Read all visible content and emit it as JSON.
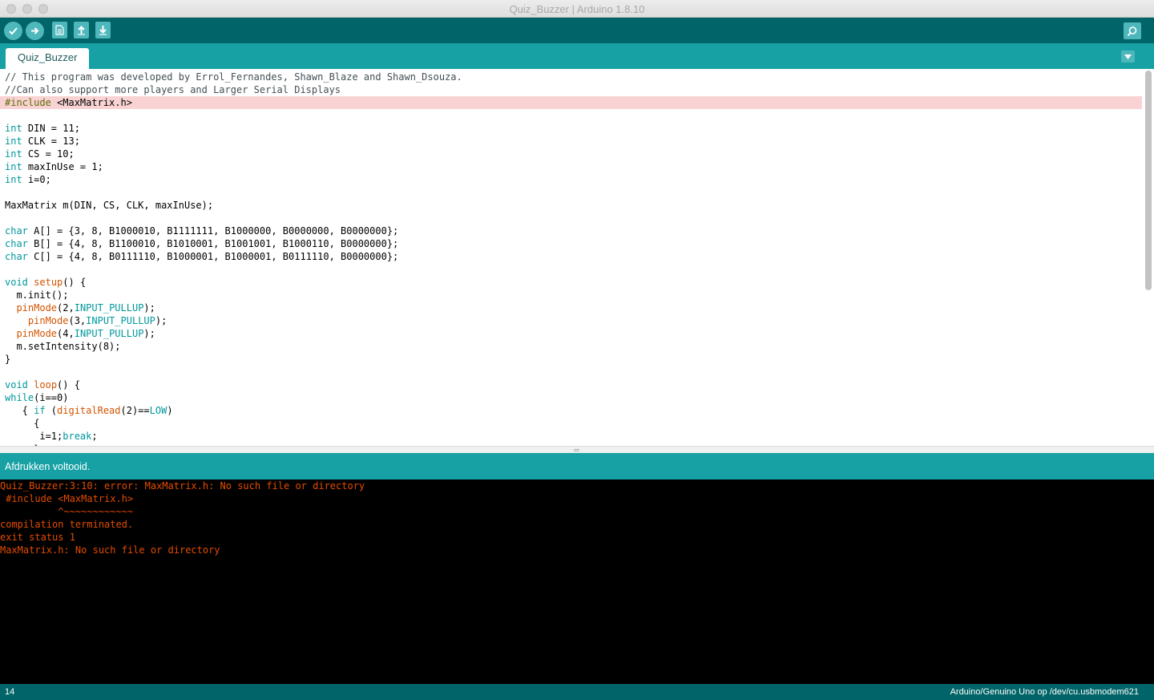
{
  "window": {
    "title": "Quiz_Buzzer | Arduino 1.8.10"
  },
  "toolbar": {
    "buttons": [
      {
        "name": "verify",
        "icon": "checkmark-icon"
      },
      {
        "name": "upload",
        "icon": "arrow-right-icon"
      },
      {
        "name": "new",
        "icon": "new-sketch-icon"
      },
      {
        "name": "open",
        "icon": "arrow-up-icon"
      },
      {
        "name": "save",
        "icon": "arrow-down-icon"
      }
    ],
    "serial_monitor_icon": "magnifier-icon"
  },
  "tabs": [
    {
      "label": "Quiz_Buzzer",
      "active": true
    }
  ],
  "editor": {
    "error_line": 3,
    "lines": [
      "// This program was developed by Errol_Fernandes, Shawn_Blaze and Shawn_Dsouza.",
      "//Can also support more players and Larger Serial Displays",
      "#include <MaxMatrix.h>",
      "",
      "int DIN = 11;",
      "int CLK = 13;",
      "int CS = 10;",
      "int maxInUse = 1;",
      "int i=0;",
      "",
      "MaxMatrix m(DIN, CS, CLK, maxInUse);",
      "",
      "char A[] = {3, 8, B1000010, B1111111, B1000000, B0000000, B0000000};",
      "char B[] = {4, 8, B1100010, B1010001, B1001001, B1000110, B0000000};",
      "char C[] = {4, 8, B0111110, B1000001, B1000001, B0111110, B0000000};",
      "",
      "void setup() {",
      "  m.init();",
      "  pinMode(2,INPUT_PULLUP);",
      "    pinMode(3,INPUT_PULLUP);",
      "  pinMode(4,INPUT_PULLUP);",
      "  m.setIntensity(8);",
      "}",
      "",
      "void loop() {",
      "while(i==0)",
      "   { if (digitalRead(2)==LOW)",
      "     {",
      "      i=1;break;",
      "     }"
    ]
  },
  "status": {
    "message": "Afdrukken voltooid."
  },
  "console": {
    "lines": [
      "Quiz_Buzzer:3:10: error: MaxMatrix.h: No such file or directory",
      " #include <MaxMatrix.h>",
      "          ^~~~~~~~~~~~~",
      "compilation terminated.",
      "exit status 1",
      "MaxMatrix.h: No such file or directory"
    ]
  },
  "footer": {
    "line_number": "14",
    "board": "Arduino/Genuino Uno op /dev/cu.usbmodem621"
  },
  "colors": {
    "toolbar": "#006468",
    "tabbar": "#17a1a5",
    "button": "#4db7bb",
    "error_text": "#e34c00",
    "error_highlight": "#f9d3d3"
  }
}
